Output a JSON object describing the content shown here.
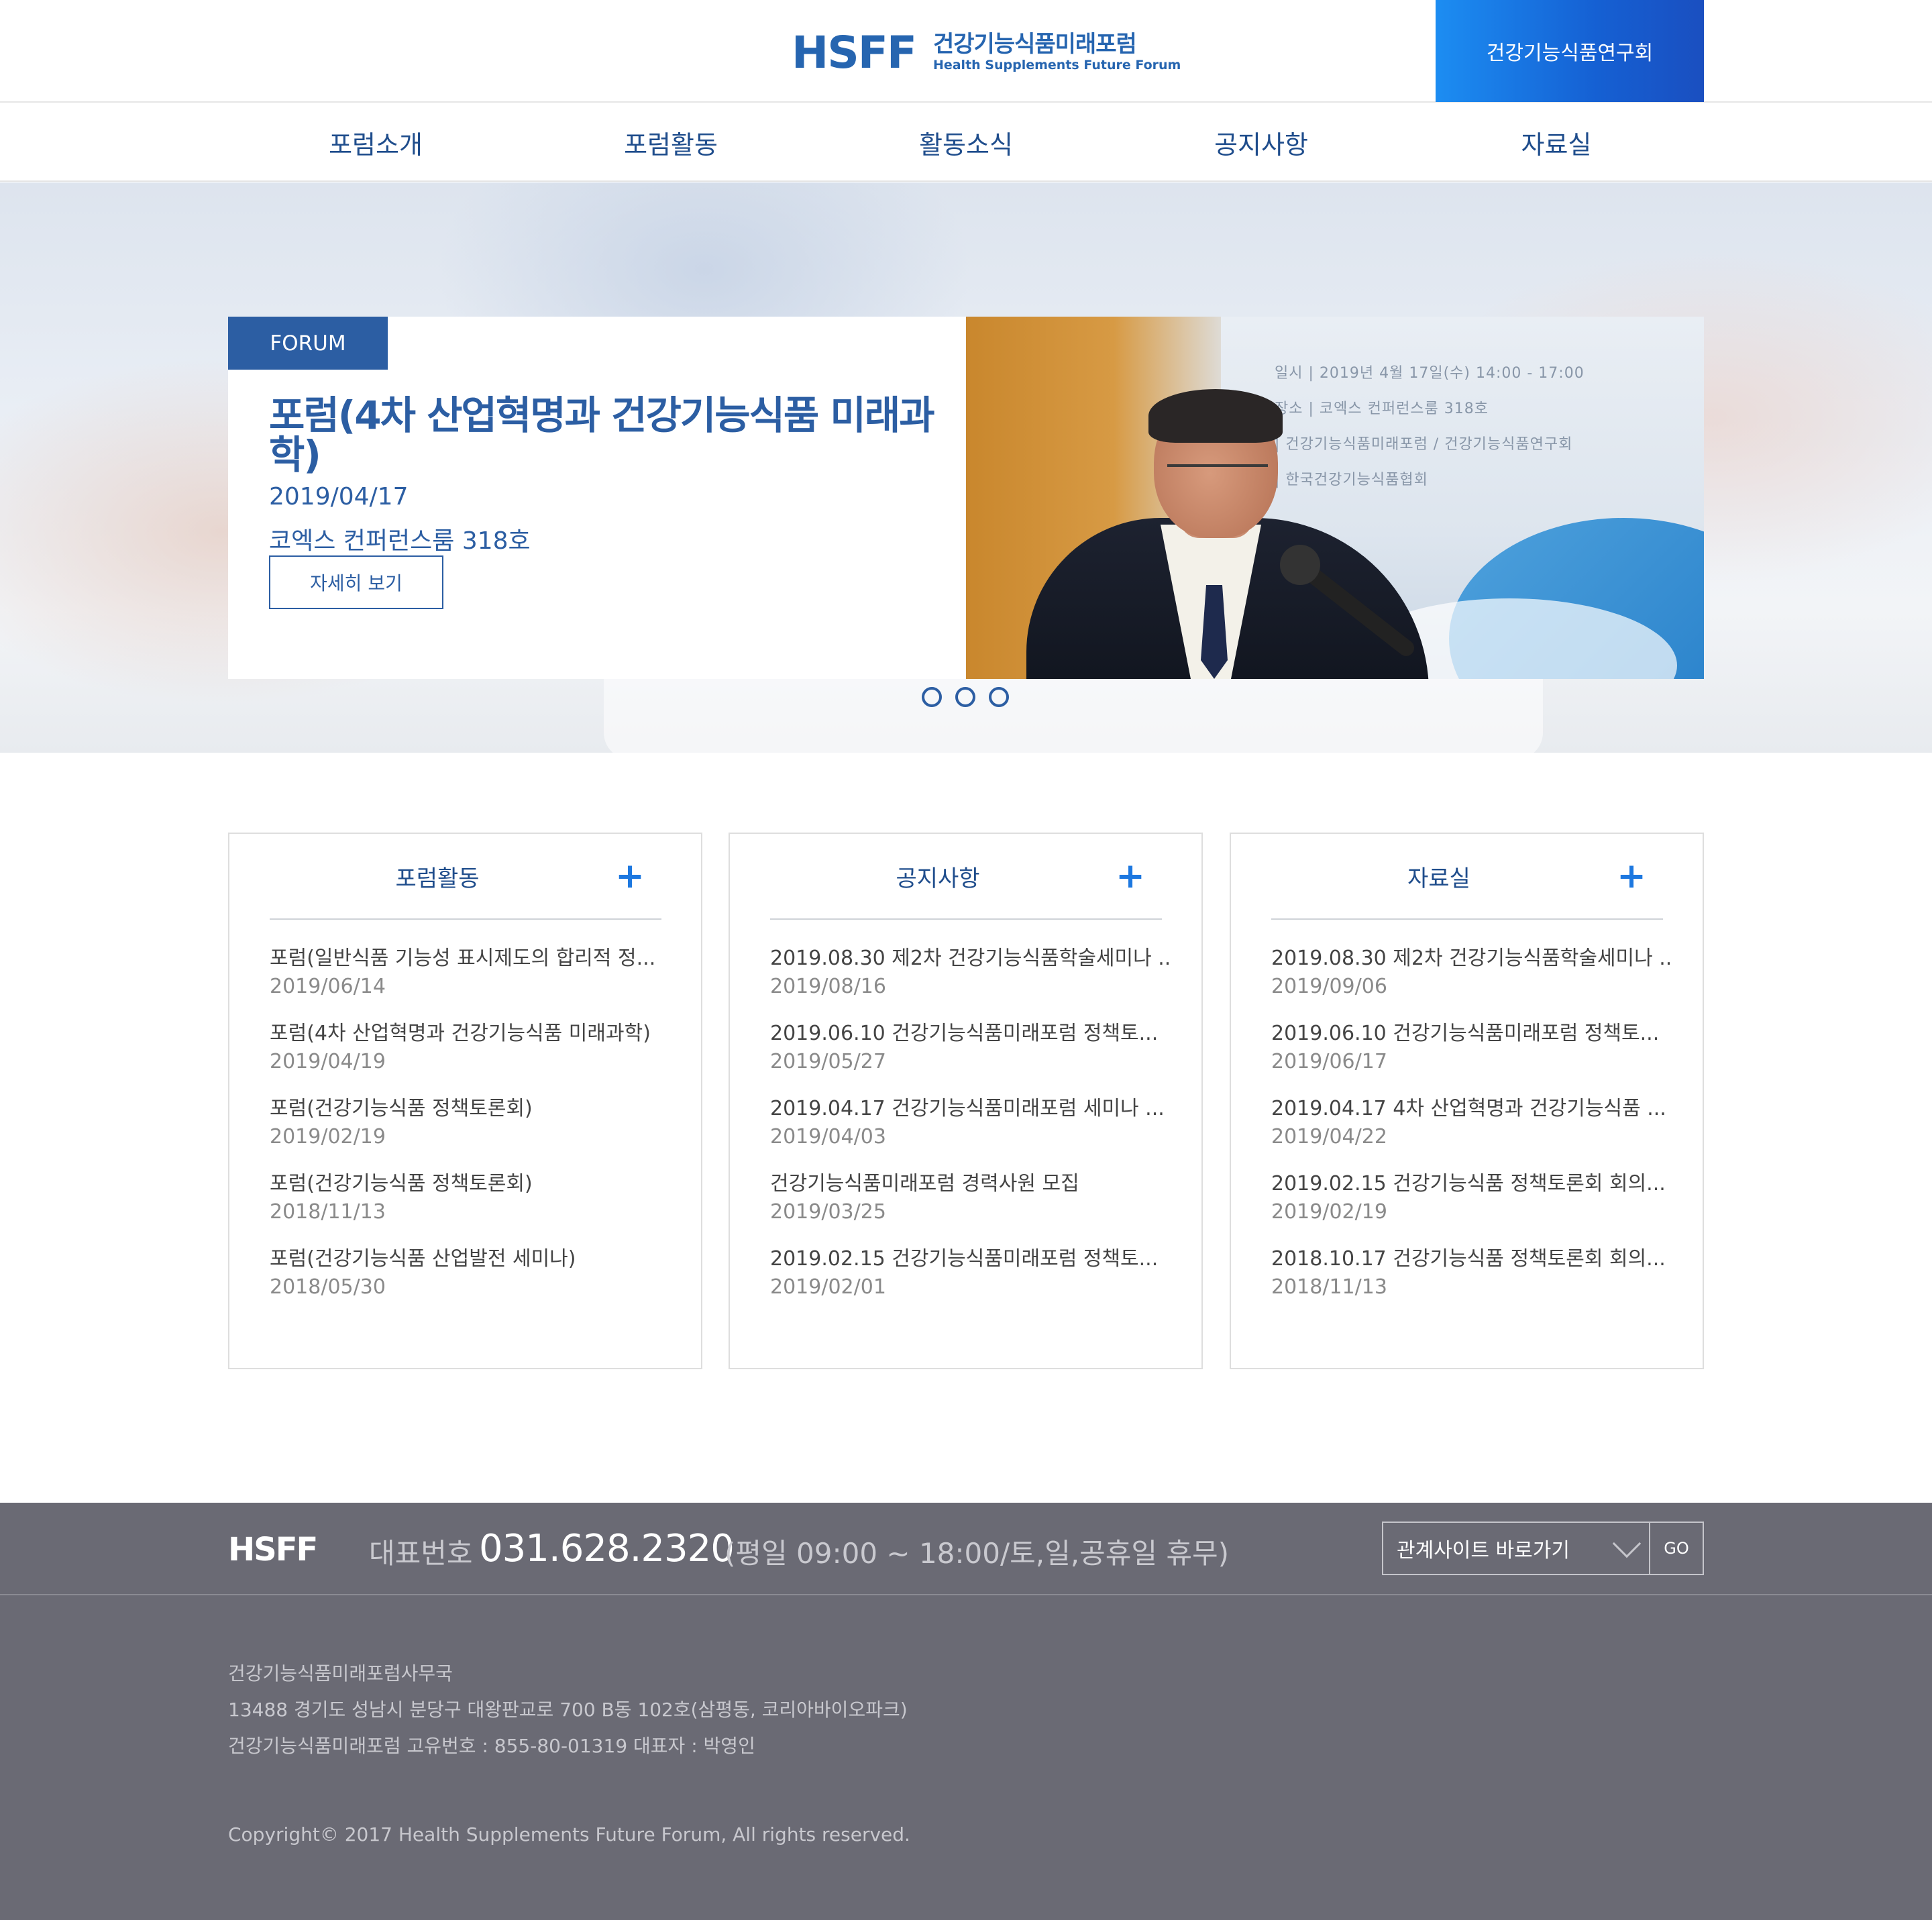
{
  "header": {
    "logo_mark": "HSFF",
    "logo_ko": "건강기능식품미래포럼",
    "logo_en": "Health Supplements Future Forum",
    "lab_button": "건강기능식품연구회",
    "accent_color": "#2665b0"
  },
  "nav": {
    "items": [
      {
        "label": "포럼소개"
      },
      {
        "label": "포럼활동"
      },
      {
        "label": "활동소식"
      },
      {
        "label": "공지사항"
      },
      {
        "label": "자료실"
      }
    ]
  },
  "hero": {
    "tag": "FORUM",
    "title": "포럼(4차 산업혁명과 건강기능식품 미래과학)",
    "date": "2019/04/17",
    "place": "코엑스 컨퍼런스룸 318호",
    "more_label": "자세히 보기",
    "photo_text": {
      "line1": "일시 | 2019년 4월 17일(수) 14:00 - 17:00",
      "line2": "장소 | 코엑스 컨퍼런스룸 318호",
      "line3": "| 건강기능식품미래포럼 / 건강기능식품연구회",
      "line4": "| 한국건강기능식품협회"
    },
    "slide_count": 3,
    "active_slide": 1
  },
  "boards": [
    {
      "title": "포럼활동",
      "more_icon": "plus-icon",
      "items": [
        {
          "title": "포럼(일반식품 기능성 표시제도의 합리적 정...",
          "date": "2019/06/14"
        },
        {
          "title": "포럼(4차 산업혁명과 건강기능식품 미래과학)",
          "date": "2019/04/19"
        },
        {
          "title": "포럼(건강기능식품 정책토론회)",
          "date": "2019/02/19"
        },
        {
          "title": "포럼(건강기능식품 정책토론회)",
          "date": "2018/11/13"
        },
        {
          "title": "포럼(건강기능식품 산업발전 세미나)",
          "date": "2018/05/30"
        }
      ]
    },
    {
      "title": "공지사항",
      "more_icon": "plus-icon",
      "items": [
        {
          "title": "2019.08.30 제2차 건강기능식품학술세미나 ...",
          "date": "2019/08/16"
        },
        {
          "title": "2019.06.10 건강기능식품미래포럼 정책토...",
          "date": "2019/05/27"
        },
        {
          "title": "2019.04.17 건강기능식품미래포럼 세미나 ...",
          "date": "2019/04/03"
        },
        {
          "title": "건강기능식품미래포럼 경력사원 모집",
          "date": "2019/03/25"
        },
        {
          "title": "2019.02.15 건강기능식품미래포럼 정책토...",
          "date": "2019/02/01"
        }
      ]
    },
    {
      "title": "자료실",
      "more_icon": "plus-icon",
      "items": [
        {
          "title": "2019.08.30 제2차 건강기능식품학술세미나 ...",
          "date": "2019/09/06"
        },
        {
          "title": "2019.06.10 건강기능식품미래포럼 정책토...",
          "date": "2019/06/17"
        },
        {
          "title": "2019.04.17 4차 산업혁명과 건강기능식품 ...",
          "date": "2019/04/22"
        },
        {
          "title": "2019.02.15 건강기능식품 정책토론회 회의...",
          "date": "2019/02/19"
        },
        {
          "title": "2018.10.17 건강기능식품 정책토론회 회의...",
          "date": "2018/11/13"
        }
      ]
    }
  ],
  "footer": {
    "logo": "HSFF",
    "phone_label": "대표번호",
    "phone": "031.628.2320",
    "hours": "(평일 09:00 ~ 18:00/토,일,공휴일 휴무)",
    "site_select": "관계사이트 바로가기",
    "go_label": "GO",
    "org": "건강기능식품미래포럼사무국",
    "address": "13488 경기도 성남시 분당구 대왕판교로 700 B동 102호(삼평동, 코리아바이오파크)",
    "reg": "건강기능식품미래포럼 고유번호 : 855-80-01319 대표자 : 박영인",
    "copyright": "Copyright© 2017 Health Supplements Future Forum, All rights reserved."
  }
}
